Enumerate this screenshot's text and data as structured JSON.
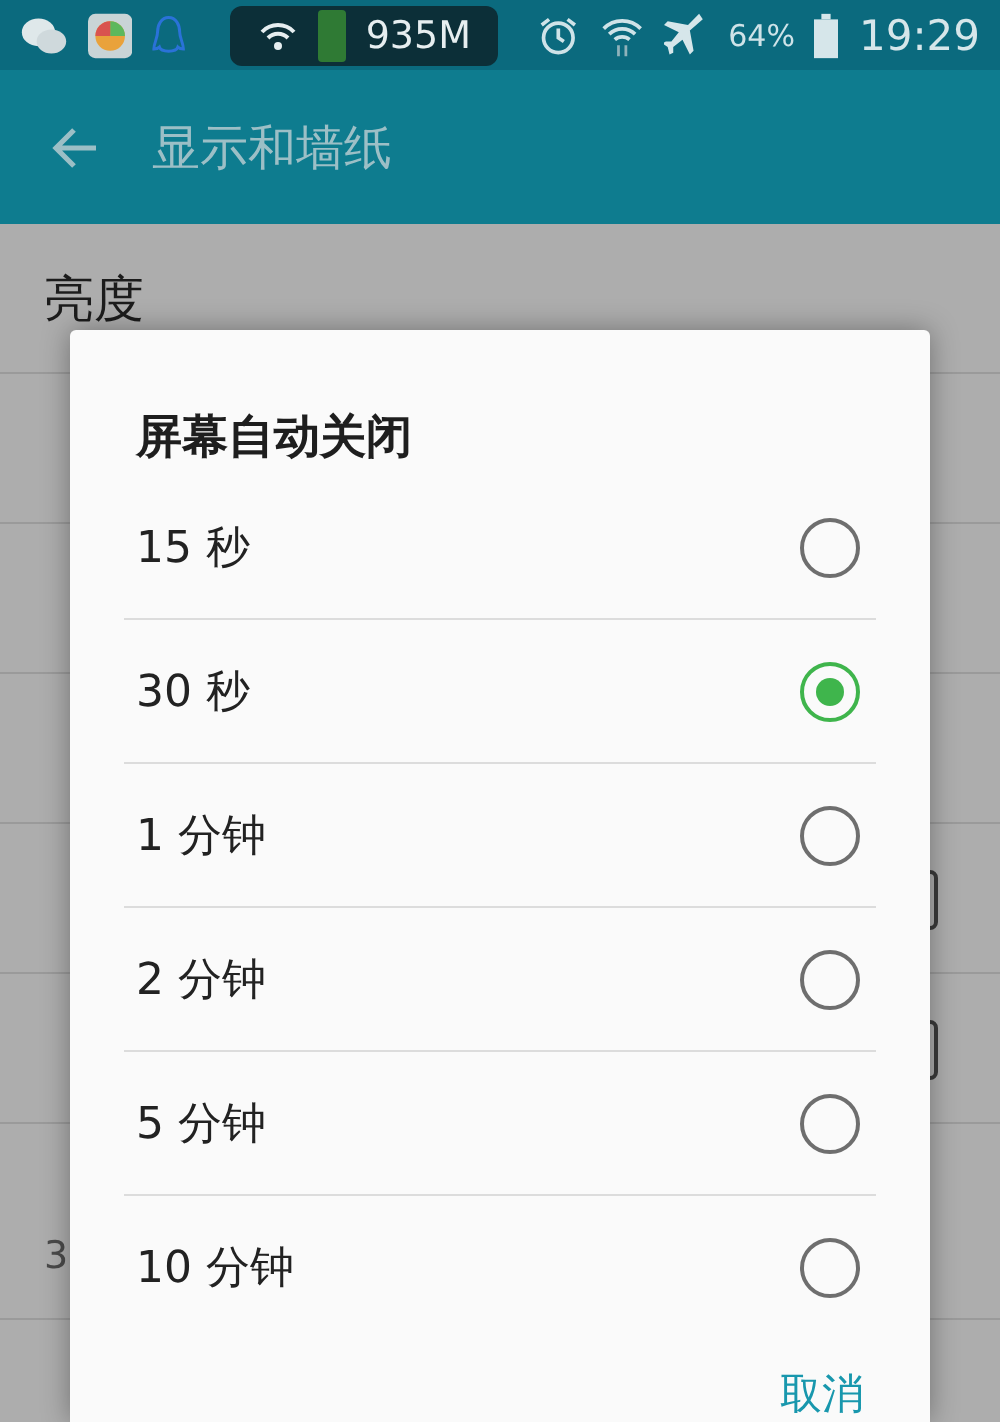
{
  "status_bar": {
    "speed": "935M",
    "battery": "64%",
    "time": "19:29"
  },
  "toolbar": {
    "title": "显示和墙纸"
  },
  "settings": [
    {
      "kind": "plain",
      "title": "亮度"
    },
    {
      "kind": "plain"
    },
    {
      "kind": "plain"
    },
    {
      "kind": "plain"
    },
    {
      "kind": "toggle"
    },
    {
      "kind": "toggle"
    },
    {
      "kind": "plain",
      "subtitle": "3"
    }
  ],
  "dialog": {
    "title": "屏幕自动关闭",
    "options": [
      {
        "label": "15 秒",
        "selected": false
      },
      {
        "label": "30 秒",
        "selected": true
      },
      {
        "label": "1 分钟",
        "selected": false
      },
      {
        "label": "2 分钟",
        "selected": false
      },
      {
        "label": "5 分钟",
        "selected": false
      },
      {
        "label": "10 分钟",
        "selected": false
      }
    ],
    "buttons": [
      "取消"
    ]
  }
}
